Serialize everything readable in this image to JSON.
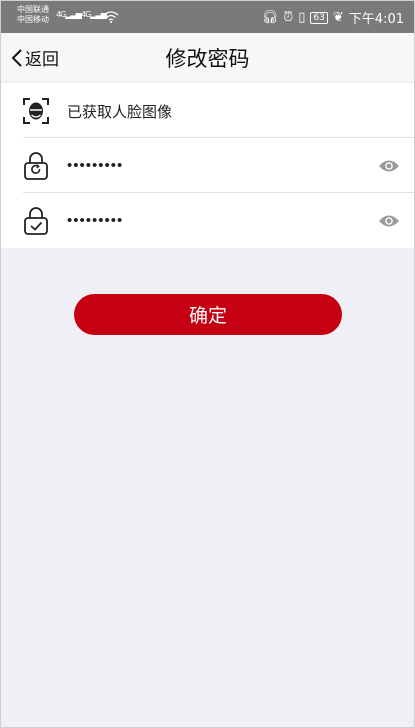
{
  "status_bar": {
    "carrier_1": "中国联通",
    "carrier_2": "中国移动",
    "net_1": "4G",
    "net_2": "4G",
    "battery": "63",
    "time": "下午4:01",
    "icons": [
      "signal-icon",
      "wifi-icon",
      "headset-icon",
      "alarm-icon",
      "vibrate-icon",
      "battery-icon",
      "leaf-icon"
    ]
  },
  "nav": {
    "back_label": "返回",
    "title": "修改密码"
  },
  "form": {
    "face_label": "已获取人脸图像",
    "new_password": "•••••••••",
    "confirm_password": "•••••••••"
  },
  "actions": {
    "confirm_label": "确定"
  },
  "colors": {
    "accent": "#c50012",
    "background": "#f0eff5",
    "status_bar": "#7a7a7a"
  }
}
